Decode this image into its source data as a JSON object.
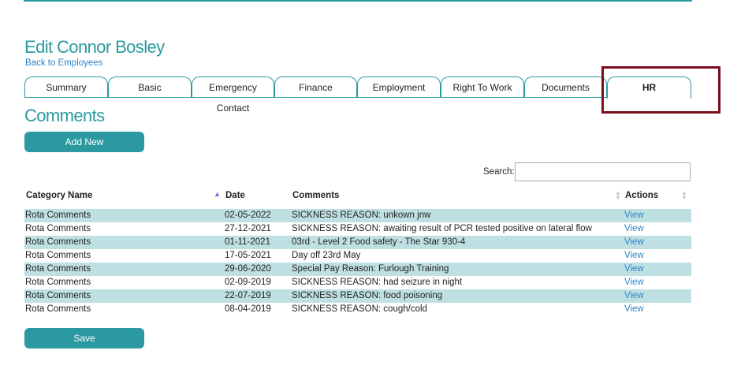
{
  "page": {
    "title": "Edit Connor Bosley",
    "back_link": "Back to Employees"
  },
  "tabs": [
    {
      "label": "Summary"
    },
    {
      "label": "Basic"
    },
    {
      "label": "Emergency Contact"
    },
    {
      "label": "Finance"
    },
    {
      "label": "Employment"
    },
    {
      "label": "Right To Work"
    },
    {
      "label": "Documents"
    },
    {
      "label": "HR",
      "active": true
    }
  ],
  "section": {
    "title": "Comments",
    "add_new": "Add New",
    "save": "Save"
  },
  "search": {
    "label": "Search:",
    "value": ""
  },
  "table": {
    "columns": [
      "Category Name",
      "Date",
      "Comments",
      "Actions"
    ],
    "rows": [
      {
        "category": "Rota Comments",
        "date": "02-05-2022",
        "comment": "SICKNESS REASON: unkown jnw",
        "action": "View"
      },
      {
        "category": "Rota Comments",
        "date": "27-12-2021",
        "comment": "SICKNESS REASON: awaiting result of PCR tested positive on lateral flow",
        "action": "View"
      },
      {
        "category": "Rota Comments",
        "date": "01-11-2021",
        "comment": "03rd - Level 2 Food safety - The Star 930-4",
        "action": "View"
      },
      {
        "category": "Rota Comments",
        "date": "17-05-2021",
        "comment": "Day off 23rd May",
        "action": "View"
      },
      {
        "category": "Rota Comments",
        "date": "29-06-2020",
        "comment": "Special Pay Reason: Furlough Training",
        "action": "View"
      },
      {
        "category": "Rota Comments",
        "date": "02-09-2019",
        "comment": "SICKNESS REASON: had seizure in night",
        "action": "View"
      },
      {
        "category": "Rota Comments",
        "date": "22-07-2019",
        "comment": "SICKNESS REASON: food poisoning",
        "action": "View"
      },
      {
        "category": "Rota Comments",
        "date": "08-04-2019",
        "comment": "SICKNESS REASON: cough/cold",
        "action": "View"
      }
    ]
  },
  "colors": {
    "accent": "#2a9aa0",
    "link": "#2f84c9",
    "row_stripe": "#bfe0e3",
    "highlight_box": "#7b0c1e"
  }
}
